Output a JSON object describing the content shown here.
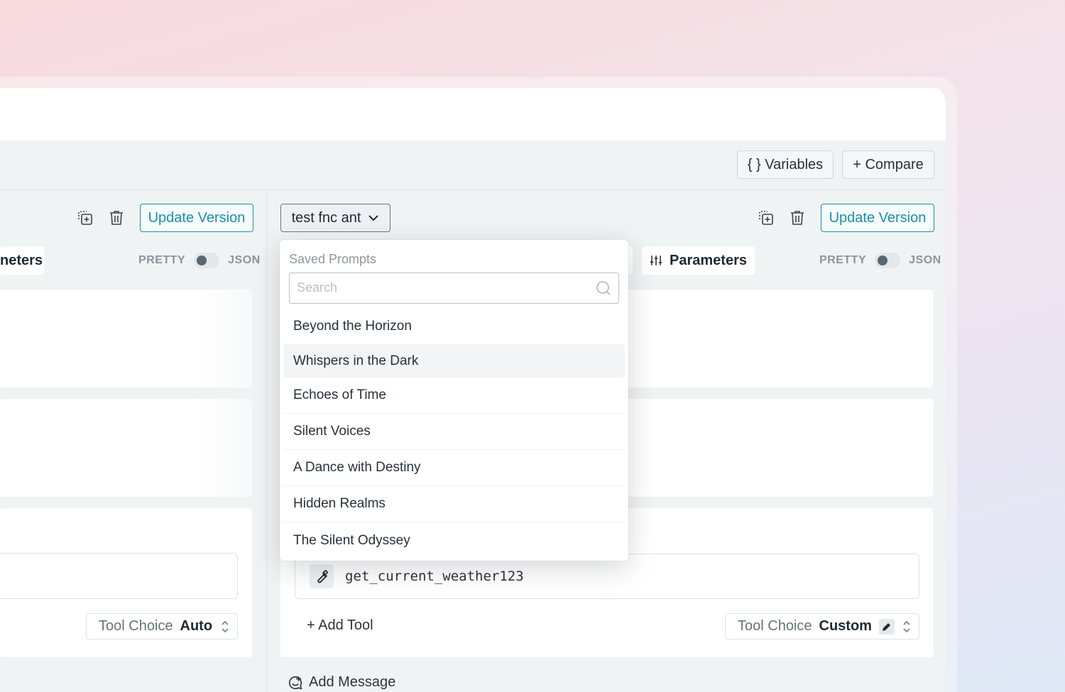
{
  "toolbar": {
    "variables_label": "{ } Variables",
    "compare_label": "+ Compare"
  },
  "left_panel": {
    "update_label": "Update Version",
    "parameters_label": "neters",
    "pretty_label": "PRETTY",
    "json_label": "JSON",
    "tool_choice_label": "Tool Choice",
    "tool_choice_value": "Auto"
  },
  "right_panel": {
    "prompt_select_label": "test fnc ant",
    "update_label": "Update Version",
    "parameters_label": "Parameters",
    "pretty_label": "PRETTY",
    "json_label": "JSON",
    "tool_name": "get_current_weather123",
    "add_tool_label": "+ Add Tool",
    "tool_choice_label": "Tool Choice",
    "tool_choice_value": "Custom",
    "add_message_label": "Add Message"
  },
  "dropdown": {
    "heading": "Saved Prompts",
    "search_placeholder": "Search",
    "items": [
      "Beyond the Horizon",
      "Whispers in the Dark",
      "Echoes of Time",
      "Silent Voices",
      "A Dance with Destiny",
      "Hidden Realms",
      "The Silent Odyssey"
    ],
    "hovered_index": 1
  },
  "icons": {
    "copy": "copy-plus-icon",
    "delete": "trash-icon",
    "chevron": "chevron-down-icon",
    "sliders": "sliders-icon",
    "wrench": "wrench-icon",
    "search": "search-icon",
    "pencil": "pencil-icon",
    "sort": "up-down-icon",
    "message": "message-plus-icon"
  },
  "colors": {
    "accent": "#1a8fad",
    "panel_bg": "#f0f3f4",
    "card_bg": "#ffffff"
  }
}
